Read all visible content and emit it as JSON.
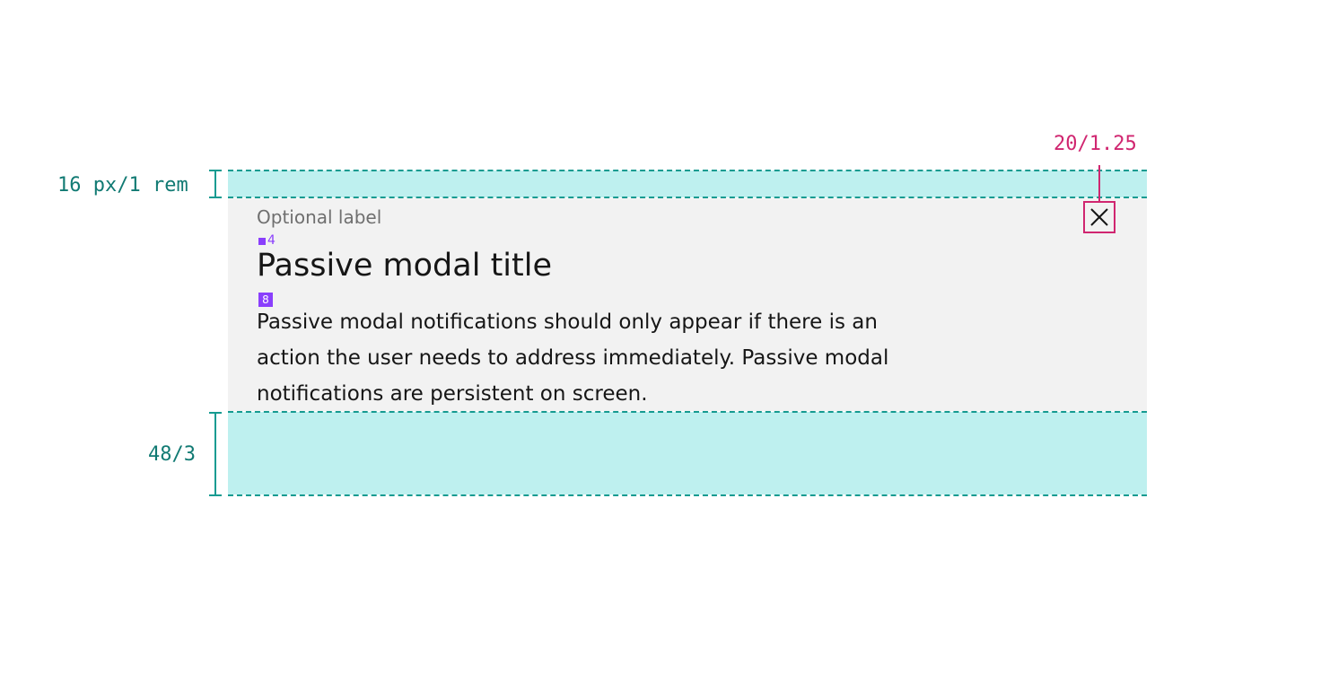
{
  "modal": {
    "label": "Optional label",
    "title": "Passive modal title",
    "body": "Passive modal notifications should only appear if there is an action the user needs to address immediately. Passive modal notifications are persistent on screen."
  },
  "spacing_tokens": {
    "label_to_title": "4",
    "title_to_body": "8"
  },
  "annotations": {
    "top_padding": "16 px/1 rem",
    "bottom_padding": "48/3",
    "close_icon_size": "20/1.25"
  },
  "icons": {
    "close": "close-icon"
  },
  "colors": {
    "spacing_band": "#bef0ef",
    "guide_line": "#159b91",
    "measure_teal": "#117a73",
    "measure_pink": "#d02670",
    "token_purple": "#8a3ffc",
    "modal_background": "#f2f2f2"
  }
}
